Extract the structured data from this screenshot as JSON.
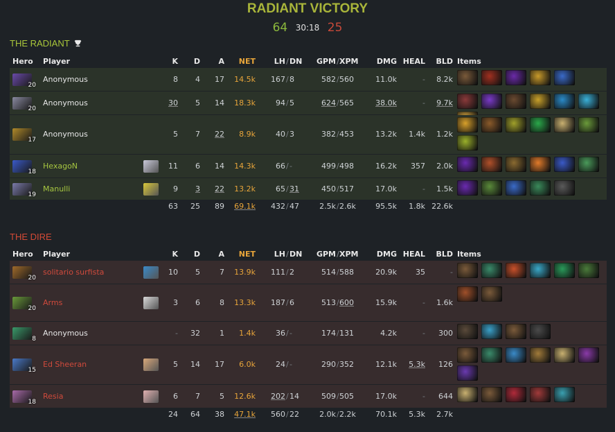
{
  "title": "RADIANT VICTORY",
  "score": {
    "radiant": "64",
    "time": "30:18",
    "dire": "25"
  },
  "columns": {
    "hero": "Hero",
    "player": "Player",
    "k": "K",
    "d": "D",
    "a": "A",
    "net": "NET",
    "lh": "LH",
    "dn": "DN",
    "gpm": "GPM",
    "xpm": "XPM",
    "dmg": "DMG",
    "heal": "HEAL",
    "bld": "BLD",
    "items": "Items"
  },
  "radiant": {
    "name": "THE RADIANT",
    "players": [
      {
        "level": "20",
        "name": "Anonymous",
        "k": "8",
        "d": "4",
        "a": "17",
        "net": "14.5k",
        "lh": "167",
        "dn": "8",
        "gpm": "582",
        "xpm": "560",
        "dmg": "11.0k",
        "heal": "-",
        "bld": "8.2k",
        "hero_color": "#6a4aa8",
        "items": [
          "#7a5a3a",
          "#a03020",
          "#6a2aa8",
          "#c89a2a",
          "#3a6ac8"
        ]
      },
      {
        "level": "20",
        "name": "Anonymous",
        "k": "30",
        "d": "5",
        "a": "14",
        "net": "18.3k",
        "lh": "94",
        "dn": "5",
        "gpm": "624",
        "xpm": "565",
        "dmg": "38.0k",
        "heal": "-",
        "bld": "9.7k",
        "hero_color": "#8a8aa0",
        "items": [
          "#8a3a3a",
          "#7a3ac8",
          "#6a4a30",
          "#c8a02a",
          "#2a8ac8",
          "#3ab0d8",
          "#c89a3a"
        ]
      },
      {
        "level": "17",
        "name": "Anonymous",
        "k": "5",
        "d": "7",
        "a": "22",
        "net": "8.9k",
        "lh": "40",
        "dn": "3",
        "gpm": "382",
        "xpm": "453",
        "dmg": "13.2k",
        "heal": "1.4k",
        "bld": "1.2k",
        "hero_color": "#b08a2a",
        "items": [
          "#d8a02a",
          "#8a5a2a",
          "#a0a02a",
          "#2aa84a",
          "#c8b070",
          "#6a9a3a",
          "#9ab02a"
        ]
      },
      {
        "level": "18",
        "name": "HexagoN",
        "k": "11",
        "d": "6",
        "a": "14",
        "net": "14.3k",
        "lh": "66",
        "dn": "-",
        "gpm": "499",
        "xpm": "498",
        "dmg": "16.2k",
        "heal": "357",
        "bld": "2.0k",
        "hero_color": "#3a5ac8",
        "avatar": "#c8c8d8",
        "items": [
          "#6a2ab0",
          "#b0502a",
          "#8a6a30",
          "#e07a2a",
          "#3a5ac8",
          "#4a9a5a"
        ]
      },
      {
        "level": "19",
        "name": "Manulli",
        "k": "9",
        "d": "3",
        "a": "22",
        "net": "13.2k",
        "lh": "65",
        "dn": "31",
        "gpm": "450",
        "xpm": "517",
        "dmg": "17.0k",
        "heal": "-",
        "bld": "1.5k",
        "hero_color": "#7a7aa8",
        "avatar": "#d8c83a",
        "items": [
          "#6a2ab0",
          "#5a8a3a",
          "#3a6ac8",
          "#3a8a5a",
          "#5a5a5a"
        ]
      }
    ],
    "totals": {
      "k": "63",
      "d": "25",
      "a": "89",
      "net": "69.1k",
      "lh": "432",
      "dn": "47",
      "gpm": "2.5k",
      "xpm": "2.6k",
      "dmg": "95.5k",
      "heal": "1.8k",
      "bld": "22.6k"
    }
  },
  "dire": {
    "name": "THE DIRE",
    "players": [
      {
        "level": "20",
        "name": "solitario surfista",
        "k": "10",
        "d": "5",
        "a": "7",
        "net": "13.9k",
        "lh": "111",
        "dn": "2",
        "gpm": "514",
        "xpm": "588",
        "dmg": "20.9k",
        "heal": "35",
        "bld": "-",
        "hero_color": "#a06a2a",
        "avatar": "#3a8ac8",
        "items": [
          "#7a5a3a",
          "#3a8a6a",
          "#c8502a",
          "#3aa8c8",
          "#2a9a5a",
          "#4a7a3a"
        ]
      },
      {
        "level": "20",
        "name": "Arms",
        "k": "3",
        "d": "6",
        "a": "8",
        "net": "13.3k",
        "lh": "187",
        "dn": "6",
        "gpm": "513",
        "xpm": "600",
        "dmg": "15.9k",
        "heal": "-",
        "bld": "1.6k",
        "hero_color": "#6a9a3a",
        "avatar": "#d8d8d8",
        "items": [
          "#a0502a",
          "#7a5a3a"
        ]
      },
      {
        "level": "8",
        "name": "Anonymous",
        "k": "-",
        "d": "32",
        "a": "1",
        "net": "1.4k",
        "lh": "36",
        "dn": "-",
        "gpm": "174",
        "xpm": "131",
        "dmg": "4.2k",
        "heal": "-",
        "bld": "300",
        "hero_color": "#3a9a6a",
        "items": [
          "#5a4a3a",
          "#3aa0c8",
          "#7a5a3a",
          "#4a4a4a"
        ]
      },
      {
        "level": "15",
        "name": "Ed Sheeran",
        "k": "5",
        "d": "14",
        "a": "17",
        "net": "6.0k",
        "lh": "24",
        "dn": "-",
        "gpm": "290",
        "xpm": "352",
        "dmg": "12.1k",
        "heal": "5.3k",
        "bld": "126",
        "hero_color": "#4a7ac8",
        "avatar": "#d8a87a",
        "items": [
          "#7a5a3a",
          "#3a8a6a",
          "#3a8ac8",
          "#a07a3a",
          "#c8b070",
          "#8a3aa8",
          "#6a3ab0"
        ]
      },
      {
        "level": "18",
        "name": "Resia",
        "k": "6",
        "d": "7",
        "a": "5",
        "net": "12.6k",
        "lh": "202",
        "dn": "14",
        "gpm": "509",
        "xpm": "505",
        "dmg": "17.0k",
        "heal": "-",
        "bld": "644",
        "hero_color": "#a86aa8",
        "avatar": "#e0b0b0",
        "items": [
          "#c8b070",
          "#7a5a3a",
          "#b02a3a",
          "#a03a3a",
          "#3aa0b0"
        ]
      }
    ],
    "totals": {
      "k": "24",
      "d": "64",
      "a": "38",
      "net": "47.1k",
      "lh": "560",
      "dn": "22",
      "gpm": "2.0k",
      "xpm": "2.2k",
      "dmg": "70.1k",
      "heal": "5.3k",
      "bld": "2.7k"
    }
  },
  "colors": {
    "radiant": "#a9c63a",
    "dire": "#d44a36",
    "net": "#e8a53a",
    "title": "#a9b53a"
  }
}
